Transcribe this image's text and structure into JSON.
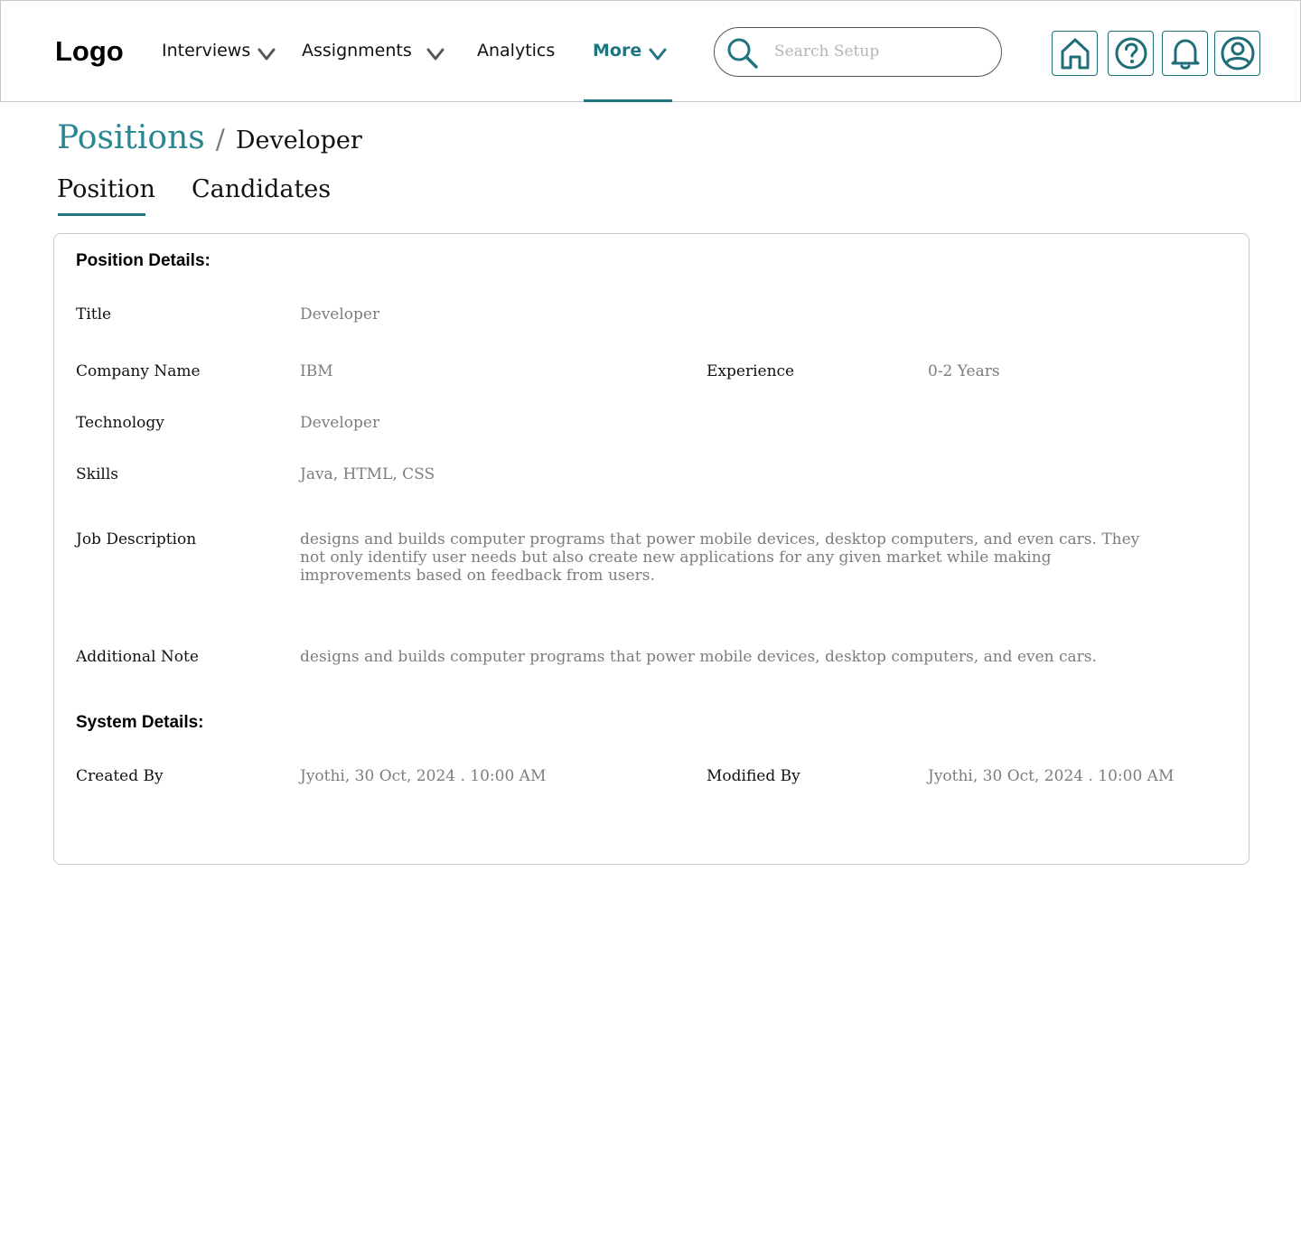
{
  "header": {
    "logo": "Logo",
    "nav": [
      {
        "label": "Interviews",
        "dropdown": true
      },
      {
        "label": "Assignments",
        "dropdown": true
      },
      {
        "label": "Analytics",
        "dropdown": false
      },
      {
        "label": "More",
        "dropdown": true,
        "active": true
      }
    ],
    "search": {
      "placeholder": "Search Setup",
      "value": ""
    },
    "icons": [
      "home-icon",
      "help-icon",
      "bell-icon",
      "user-icon"
    ]
  },
  "breadcrumb": {
    "parent": "Positions",
    "separator": "/",
    "current": "Developer"
  },
  "tabs": [
    {
      "label": "Position",
      "active": true
    },
    {
      "label": "Candidates",
      "active": false
    }
  ],
  "position_details": {
    "heading": "Position Details:",
    "title_label": "Title",
    "title_value": "Developer",
    "company_label": "Company Name",
    "company_value": "IBM",
    "experience_label": "Experience",
    "experience_value": "0-2 Years",
    "technology_label": "Technology",
    "technology_value": "Developer",
    "skills_label": "Skills",
    "skills_value": "Java, HTML, CSS",
    "job_description_label": "Job Description",
    "job_description_value": "designs and builds computer programs that power mobile devices, desktop computers, and even cars. They not only identify user needs but also create new applications for any given market while making improvements based on feedback from users.",
    "additional_note_label": "Additional Note",
    "additional_note_value": "designs and builds computer programs that power mobile devices, desktop computers, and even cars."
  },
  "system_details": {
    "heading": "System Details:",
    "created_by_label": "Created By",
    "created_by_value": "Jyothi, 30 Oct, 2024 . 10:00 AM",
    "modified_by_label": "Modified By",
    "modified_by_value": "Jyothi, 30 Oct, 2024 . 10:00 AM"
  },
  "colors": {
    "accent": "#1f7580",
    "breadcrumb_link": "#2a8690",
    "muted_text": "#7d7d7d",
    "border": "#c9c9c9"
  }
}
